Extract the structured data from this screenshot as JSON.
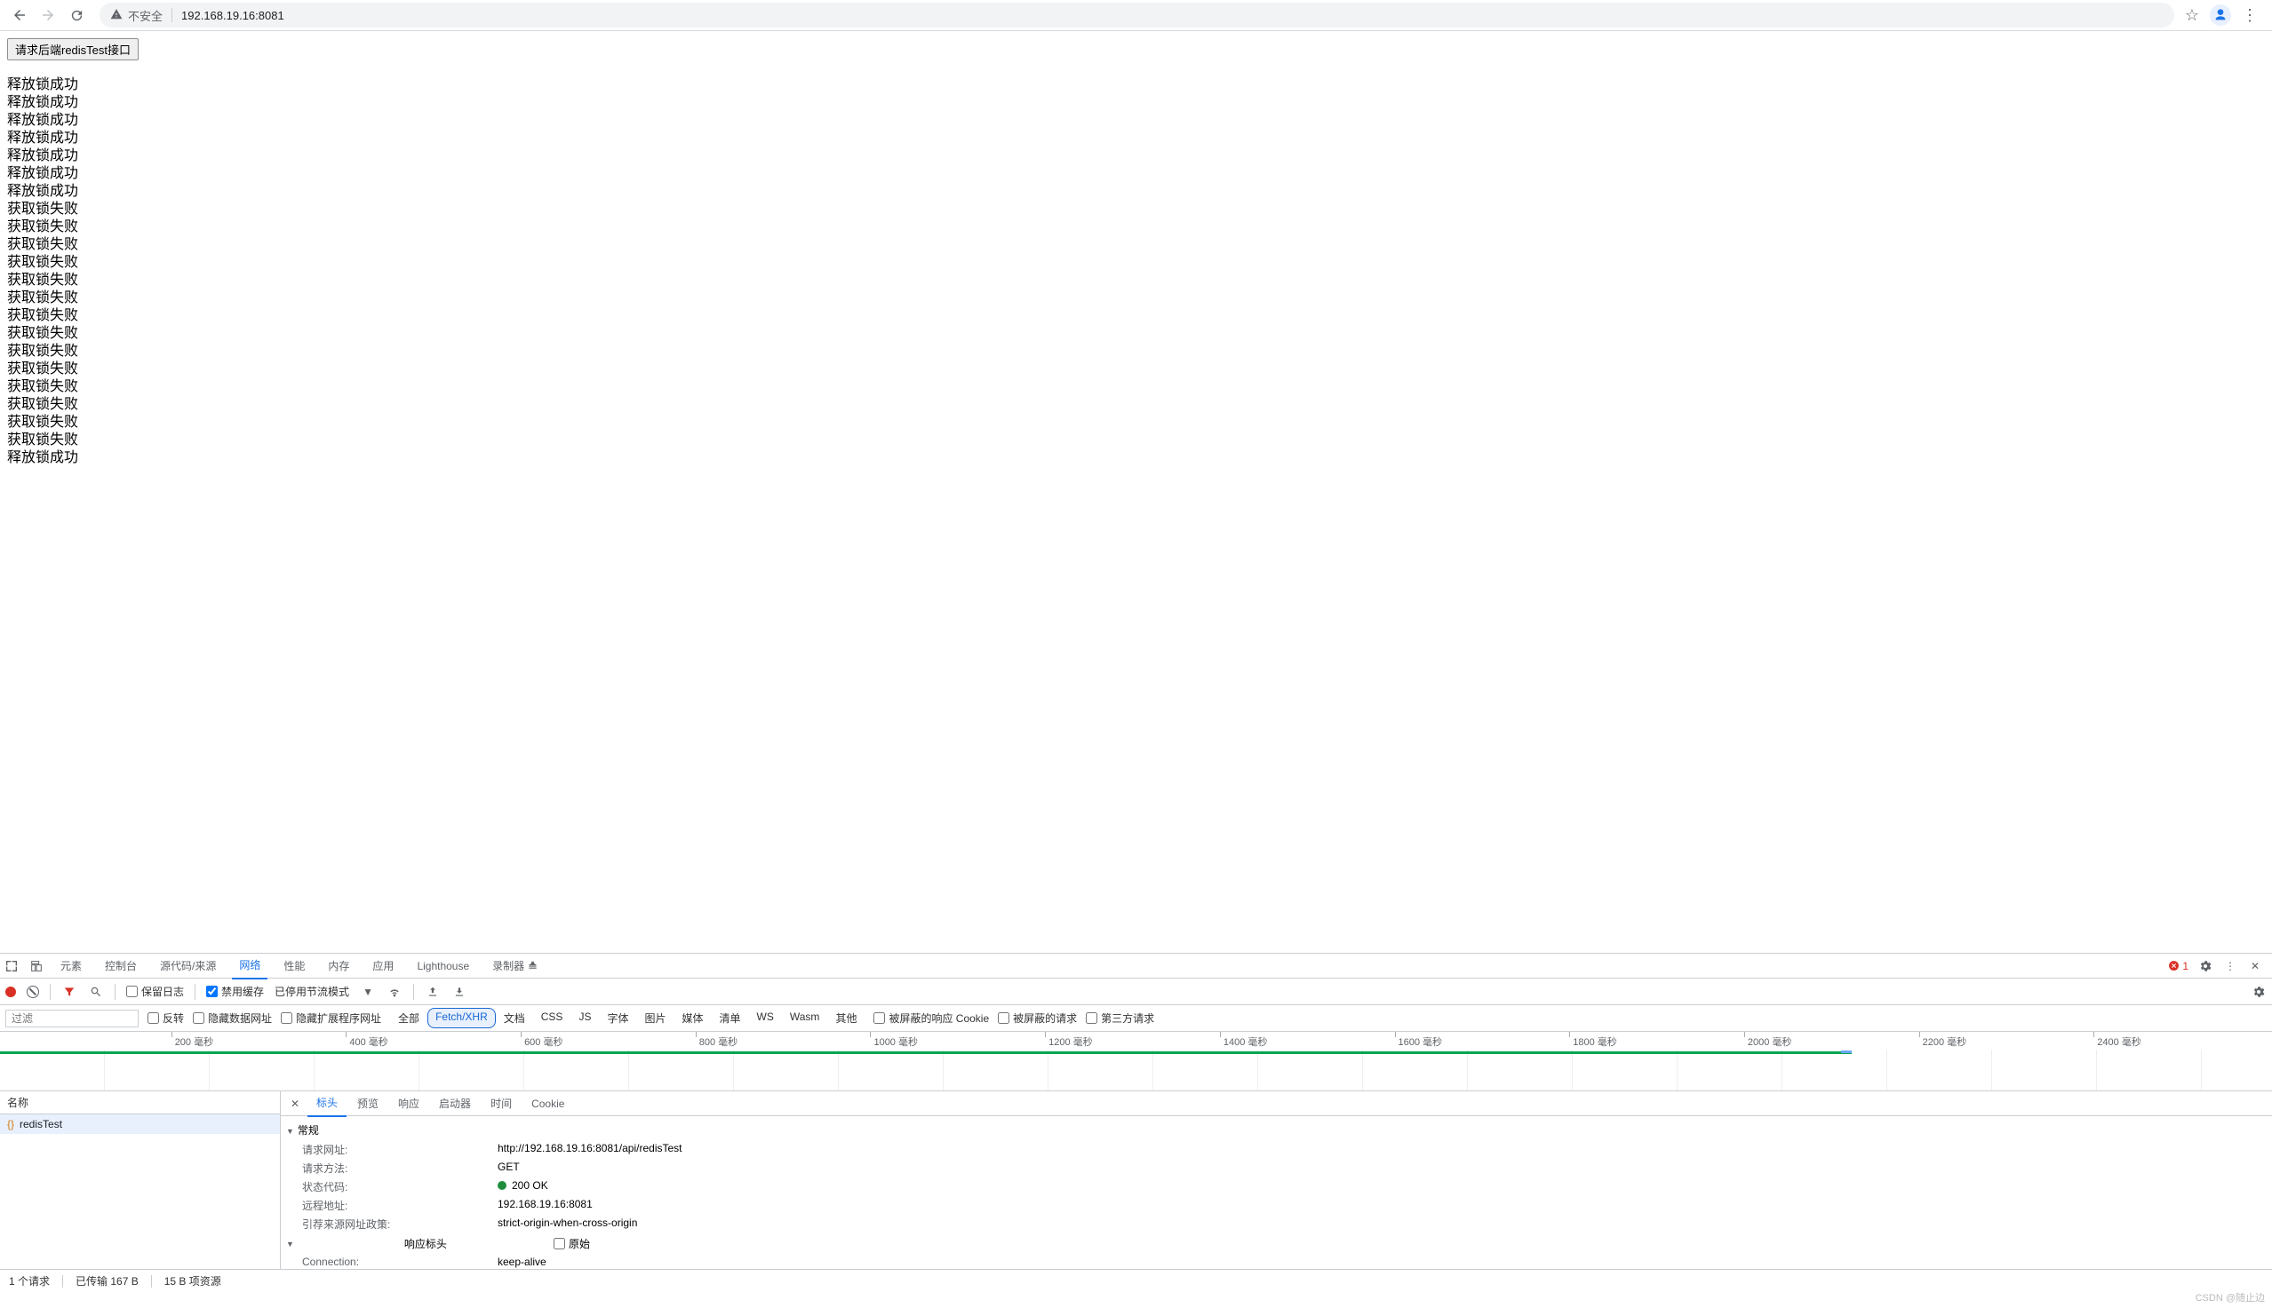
{
  "browser": {
    "security_label": "不安全",
    "url": "192.168.19.16:8081"
  },
  "page": {
    "button_label": "请求后端redisTest接口",
    "lines": [
      "释放锁成功",
      "释放锁成功",
      "释放锁成功",
      "释放锁成功",
      "释放锁成功",
      "释放锁成功",
      "释放锁成功",
      "获取锁失败",
      "获取锁失败",
      "获取锁失败",
      "获取锁失败",
      "获取锁失败",
      "获取锁失败",
      "获取锁失败",
      "获取锁失败",
      "获取锁失败",
      "获取锁失败",
      "获取锁失败",
      "获取锁失败",
      "获取锁失败",
      "获取锁失败",
      "释放锁成功"
    ]
  },
  "devtools": {
    "tabs": {
      "elements": "元素",
      "console": "控制台",
      "sources": "源代码/来源",
      "network": "网络",
      "performance": "性能",
      "memory": "内存",
      "application": "应用",
      "lighthouse": "Lighthouse",
      "recorder": "录制器"
    },
    "error_count": "1",
    "toolbar": {
      "preserve_log": "保留日志",
      "disable_cache": "禁用缓存",
      "throttling": "已停用节流模式"
    },
    "filters": {
      "placeholder": "过滤",
      "invert": "反转",
      "hide_data_urls": "隐藏数据网址",
      "hide_ext_urls": "隐藏扩展程序网址",
      "all": "全部",
      "fetch_xhr": "Fetch/XHR",
      "doc": "文档",
      "css": "CSS",
      "js": "JS",
      "font": "字体",
      "img": "图片",
      "media": "媒体",
      "manifest": "清单",
      "ws": "WS",
      "wasm": "Wasm",
      "other": "其他",
      "blocked_cookies": "被屏蔽的响应 Cookie",
      "blocked_requests": "被屏蔽的请求",
      "third_party": "第三方请求"
    },
    "timeline_ticks": [
      "200 毫秒",
      "400 毫秒",
      "600 毫秒",
      "800 毫秒",
      "1000 毫秒",
      "1200 毫秒",
      "1400 毫秒",
      "1600 毫秒",
      "1800 毫秒",
      "2000 毫秒",
      "2200 毫秒",
      "2400 毫秒"
    ],
    "list": {
      "header": "名称",
      "item_name": "redisTest"
    },
    "detail_tabs": {
      "headers": "标头",
      "preview": "预览",
      "response": "响应",
      "initiator": "启动器",
      "timing": "时间",
      "cookies": "Cookie"
    },
    "headers": {
      "general_label": "常规",
      "request_url_k": "请求网址:",
      "request_url_v": "http://192.168.19.16:8081/api/redisTest",
      "request_method_k": "请求方法:",
      "request_method_v": "GET",
      "status_code_k": "状态代码:",
      "status_code_v": "200 OK",
      "remote_addr_k": "远程地址:",
      "remote_addr_v": "192.168.19.16:8081",
      "referrer_policy_k": "引荐来源网址政策:",
      "referrer_policy_v": "strict-origin-when-cross-origin",
      "response_headers_label": "响应标头",
      "raw_label": "原始",
      "connection_k": "Connection:",
      "connection_v": "keep-alive"
    },
    "status_bar": {
      "requests": "1 个请求",
      "transfer": "已传输 167 B",
      "resources": "15 B 项资源"
    },
    "watermark": "CSDN @随止边"
  }
}
